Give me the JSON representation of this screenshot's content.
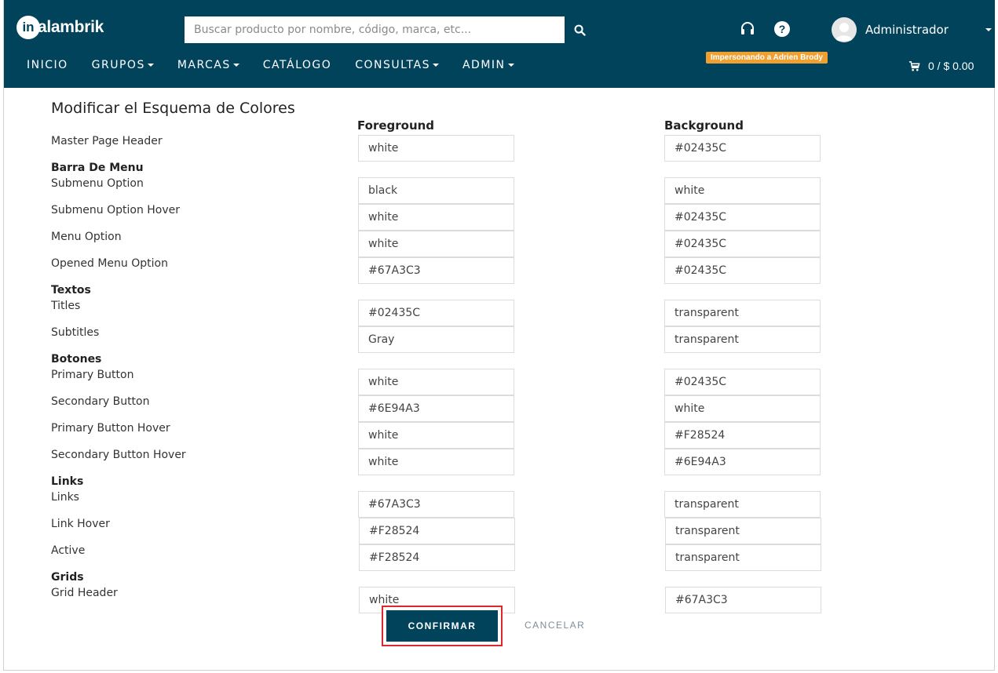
{
  "header": {
    "logo_mark": "in",
    "logo_text": "alambrik",
    "search_placeholder": "Buscar producto por nombre, código, marca, etc...",
    "user_name": "Administrador",
    "impersonation_badge": "Impersonando a Adrien Brody",
    "cart_summary": "0 / $ 0.00",
    "help_glyph": "?",
    "icons": [
      "search-icon",
      "headset-icon",
      "help-icon",
      "avatar",
      "cart-icon"
    ],
    "background_color": "#02435C",
    "badge_color": "#F0A030"
  },
  "nav": {
    "items": [
      {
        "label": "INICIO",
        "dropdown": false
      },
      {
        "label": "GRUPOS",
        "dropdown": true
      },
      {
        "label": "MARCAS",
        "dropdown": true
      },
      {
        "label": "CATÁLOGO",
        "dropdown": false
      },
      {
        "label": "CONSULTAS",
        "dropdown": true
      },
      {
        "label": "ADMIN",
        "dropdown": true
      }
    ]
  },
  "main": {
    "title": "Modificar el Esquema de Colores",
    "col_foreground": "Foreground",
    "col_background": "Background",
    "sections": {
      "menu": "Barra De Menu",
      "texts": "Textos",
      "buttons": "Botones",
      "links": "Links",
      "grids": "Grids"
    },
    "rows": [
      {
        "label": "Master Page Header",
        "foreground": "white",
        "background": "#02435C"
      },
      {
        "label": "Submenu Option",
        "foreground": "black",
        "background": "white"
      },
      {
        "label": "Submenu Option Hover",
        "foreground": "white",
        "background": "#02435C"
      },
      {
        "label": "Menu Option",
        "foreground": "white",
        "background": "#02435C"
      },
      {
        "label": "Opened Menu Option",
        "foreground": "#67A3C3",
        "background": "#02435C"
      },
      {
        "label": "Titles",
        "foreground": "#02435C",
        "background": "transparent"
      },
      {
        "label": "Subtitles",
        "foreground": "Gray",
        "background": "transparent"
      },
      {
        "label": "Primary Button",
        "foreground": "white",
        "background": "#02435C"
      },
      {
        "label": "Secondary Button",
        "foreground": "#6E94A3",
        "background": "white"
      },
      {
        "label": "Primary Button Hover",
        "foreground": "white",
        "background": "#F28524"
      },
      {
        "label": "Secondary Button Hover",
        "foreground": "white",
        "background": "#6E94A3"
      },
      {
        "label": "Links",
        "foreground": "#67A3C3",
        "background": "transparent"
      },
      {
        "label": "Link Hover",
        "foreground": "#F28524",
        "background": "transparent"
      },
      {
        "label": "Active",
        "foreground": "#F28524",
        "background": "transparent"
      },
      {
        "label": "Grid Header",
        "foreground": "white",
        "background": "#67A3C3"
      }
    ]
  },
  "actions": {
    "confirm_label": "CONFIRMAR",
    "cancel_label": "CANCELAR",
    "highlight_color": "#e0262b"
  }
}
